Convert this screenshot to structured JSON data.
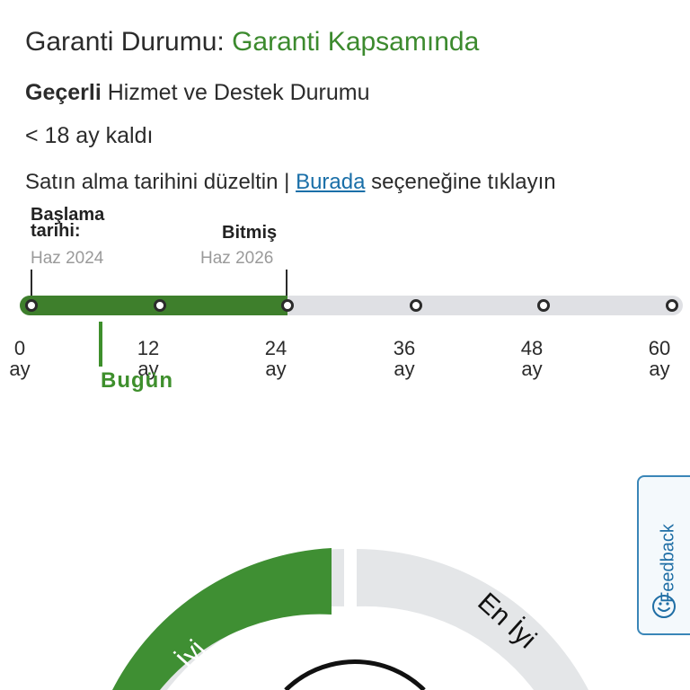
{
  "warranty": {
    "title_prefix": "Garanti Durumu:",
    "status": "Garanti Kapsamında",
    "service_bold": "Geçerli",
    "service_rest": "Hizmet ve Destek Durumu",
    "remaining": "< 18 ay kaldı",
    "fix_text_pre": "Satın alma tarihini düzeltin |",
    "fix_link": "Burada",
    "fix_text_post": "seçeneğine tıklayın"
  },
  "timeline": {
    "start_label_line1": "Başlama",
    "start_label_line2": "tarihi:",
    "start_date": "Haz 2024",
    "end_label": "Bitmiş",
    "end_date": "Haz 2026",
    "axis": [
      "0",
      "12",
      "24",
      "36",
      "48",
      "60"
    ],
    "axis_unit": "ay",
    "today_label": "Bugün",
    "covered_months": 24,
    "elapsed_months": 6.5,
    "max_months": 60
  },
  "feedback": {
    "label": "Feedback"
  },
  "gauge": {
    "segment_good": "İyi",
    "segment_best": "En İyi",
    "colors": {
      "good": "#3f8f33",
      "track": "#e4e6e8"
    }
  },
  "colors": {
    "accent_green": "#3c8a2e",
    "link": "#1a6fa8"
  }
}
